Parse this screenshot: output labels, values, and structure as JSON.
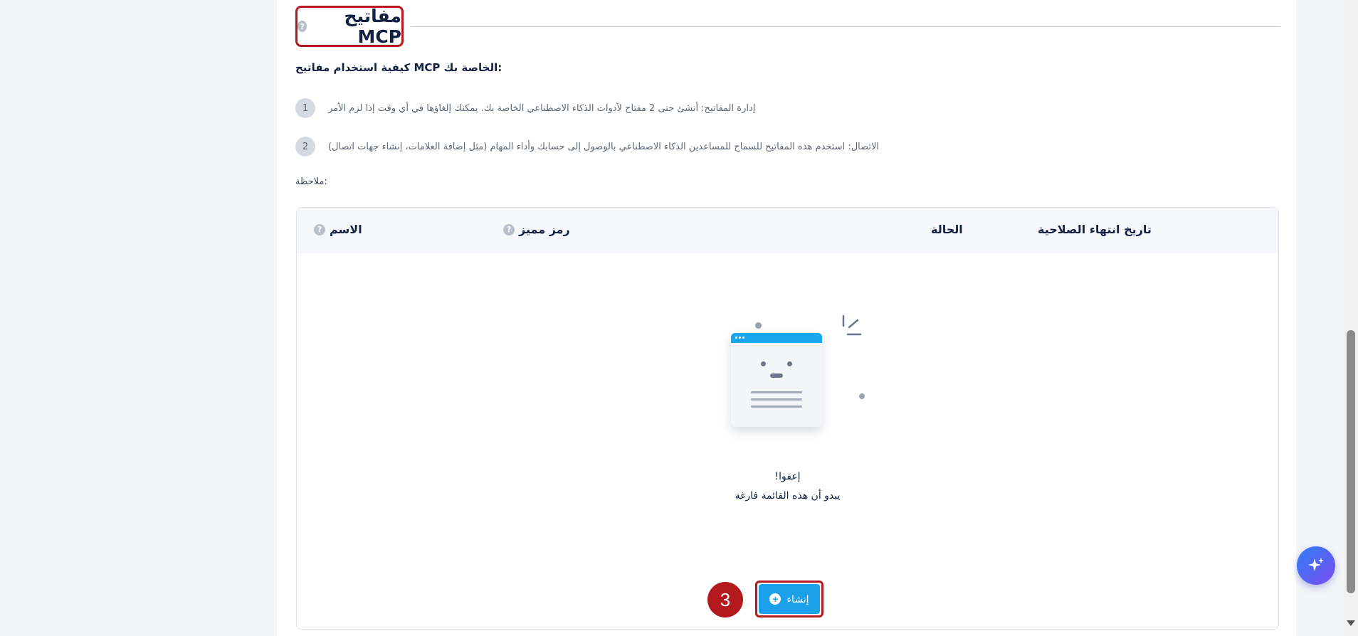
{
  "section": {
    "title": "مفاتيح MCP",
    "help_glyph": "?",
    "how_to_heading": ":الخاصة بك MCP كيفية استخدام مفاتيح",
    "steps": [
      {
        "num": "1",
        "text": "إدارة المفاتيح: أنشئ حتى 2 مفتاح لأدوات الذكاء الاصطناعي الخاصة بك. يمكنك إلغاؤها في أي وقت إذا لزم الأمر"
      },
      {
        "num": "2",
        "text": "الاتصال: استخدم هذه المفاتيح للسماح للمساعدين الذكاء الاصطناعي بالوصول إلى حسابك وأداء المهام (مثل إضافة العلامات، إنشاء جهات اتصال)"
      }
    ],
    "note_label": ":ملاحظة"
  },
  "table": {
    "columns": {
      "name": "الاسم",
      "token": "رمز مميز",
      "status": "الحالة",
      "expiry": "تاريخ انتهاء الصلاحية"
    },
    "empty_title": "إعفوا!",
    "empty_subtitle": "يبدو أن هذه القائمة فارغة",
    "create_label": "إنشاء",
    "create_icon": "+"
  },
  "annotation": {
    "step_number": "3"
  },
  "colors": {
    "accent": "#1ba0ea",
    "highlight": "#b3191d",
    "fab_gradient_start": "#2f7ef6",
    "fab_gradient_end": "#7b4df0"
  },
  "icons": {
    "help": "help-circle-icon",
    "create": "plus-circle-icon",
    "assistant": "sparkle-icon"
  }
}
